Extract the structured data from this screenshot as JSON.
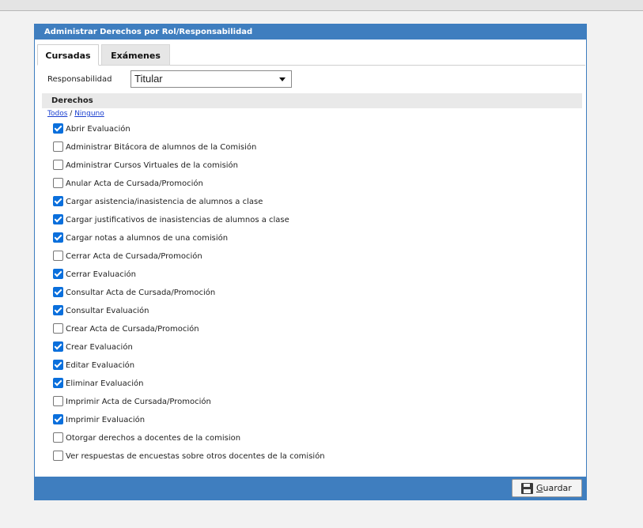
{
  "panel": {
    "title": "Administrar Derechos por Rol/Responsabilidad",
    "tabs": [
      {
        "label": "Cursadas",
        "active": true
      },
      {
        "label": "Exámenes",
        "active": false
      }
    ]
  },
  "responsabilidad": {
    "label": "Responsabilidad",
    "selected": "Titular"
  },
  "derechos": {
    "header": "Derechos",
    "select_all": "Todos",
    "separator": "/",
    "select_none": "Ninguno",
    "items": [
      {
        "label": "Abrir Evaluación",
        "checked": true
      },
      {
        "label": "Administrar Bitácora de alumnos de la Comisión",
        "checked": false
      },
      {
        "label": "Administrar Cursos Virtuales de la comisión",
        "checked": false
      },
      {
        "label": "Anular Acta de Cursada/Promoción",
        "checked": false
      },
      {
        "label": "Cargar asistencia/inasistencia de alumnos a clase",
        "checked": true
      },
      {
        "label": "Cargar justificativos de inasistencias de alumnos a clase",
        "checked": true
      },
      {
        "label": "Cargar notas a alumnos de una comisión",
        "checked": true
      },
      {
        "label": "Cerrar Acta de Cursada/Promoción",
        "checked": false
      },
      {
        "label": "Cerrar Evaluación",
        "checked": true
      },
      {
        "label": "Consultar Acta de Cursada/Promoción",
        "checked": true
      },
      {
        "label": "Consultar Evaluación",
        "checked": true
      },
      {
        "label": "Crear Acta de Cursada/Promoción",
        "checked": false
      },
      {
        "label": "Crear Evaluación",
        "checked": true
      },
      {
        "label": "Editar Evaluación",
        "checked": true
      },
      {
        "label": "Eliminar Evaluación",
        "checked": true
      },
      {
        "label": "Imprimir Acta de Cursada/Promoción",
        "checked": false
      },
      {
        "label": "Imprimir Evaluación",
        "checked": true
      },
      {
        "label": "Otorgar derechos a docentes de la comision",
        "checked": false
      },
      {
        "label": "Ver respuestas de encuestas sobre otros docentes de la comisión",
        "checked": false
      }
    ]
  },
  "footer": {
    "save_accel": "G",
    "save_rest": "uardar",
    "save_icon": "floppy-disk-icon"
  },
  "colors": {
    "header_blue": "#3f7ebf",
    "checkbox_blue": "#0a6fdc",
    "link_blue": "#1a3fcf"
  }
}
